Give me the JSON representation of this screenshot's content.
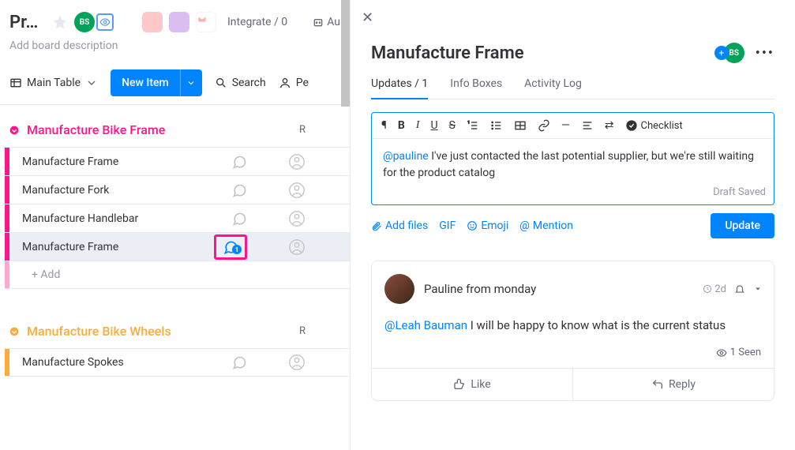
{
  "header": {
    "title": "Pr…",
    "description": "Add board description",
    "main_table": "Main Table",
    "new_item": "New Item",
    "search": "Search",
    "person_short": "Pe",
    "integrate": "Integrate / 0",
    "automate_short": "Au"
  },
  "groups": [
    {
      "name": "Manufacture Bike Frame",
      "color": "pink",
      "col_header": "R",
      "rows": [
        {
          "name": "Manufacture Frame",
          "selected": false,
          "highlighted": false,
          "has_chat_highlight": false
        },
        {
          "name": "Manufacture Fork",
          "selected": false,
          "highlighted": false,
          "has_chat_highlight": false
        },
        {
          "name": "Manufacture Handlebar",
          "selected": false,
          "highlighted": false,
          "has_chat_highlight": false
        },
        {
          "name": "Manufacture Frame",
          "selected": false,
          "highlighted": true,
          "has_chat_highlight": true,
          "chat_count": "1"
        }
      ],
      "add_label": "+ Add"
    },
    {
      "name": "Manufacture Bike Wheels",
      "color": "orange",
      "col_header": "R",
      "rows": [
        {
          "name": "Manufacture Spokes",
          "selected": false,
          "highlighted": false,
          "has_chat_highlight": false
        }
      ]
    }
  ],
  "panel": {
    "title": "Manufacture Frame",
    "avatar_initials": "BS",
    "tabs": {
      "updates": "Updates / 1",
      "info_boxes": "Info Boxes",
      "activity_log": "Activity Log"
    },
    "editor": {
      "checklist_label": "Checklist",
      "mention": "@pauline",
      "text": " I've just contacted the last potential supplier, but we're still waiting for the product catalog",
      "draft_saved": "Draft Saved",
      "add_files": "Add files",
      "gif": "GIF",
      "emoji": "Emoji",
      "mention_action": "Mention",
      "update_btn": "Update"
    },
    "comment": {
      "author": "Pauline from monday",
      "time": "2d",
      "mention": "@Leah Bauman",
      "body": " I will be happy to know what is the current status",
      "seen": "1 Seen",
      "like": "Like",
      "reply": "Reply"
    }
  }
}
